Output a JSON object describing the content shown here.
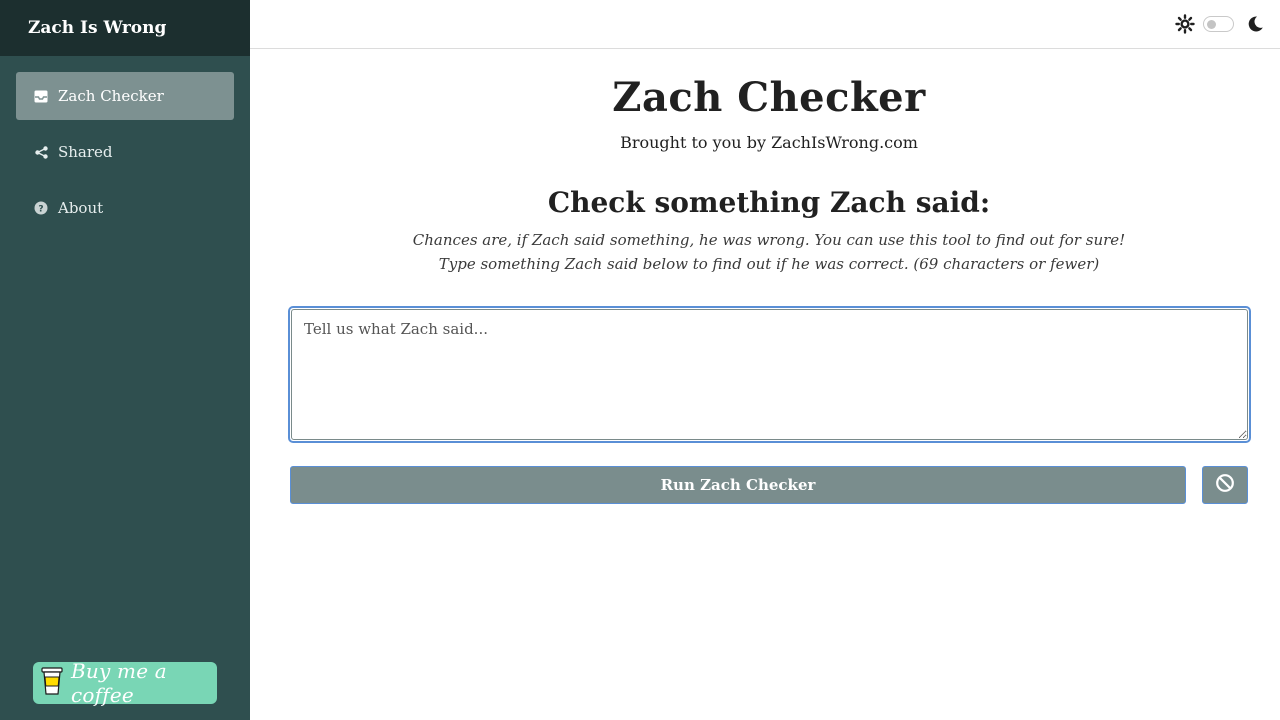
{
  "app": {
    "brand": "Zach Is Wrong"
  },
  "sidebar": {
    "items": [
      {
        "label": "Zach Checker",
        "icon": "inbox-icon",
        "active": true
      },
      {
        "label": "Shared",
        "icon": "share-icon",
        "active": false
      },
      {
        "label": "About",
        "icon": "help-circle-icon",
        "active": false
      }
    ],
    "coffee_label": "Buy me a coffee"
  },
  "topbar": {
    "theme_icons": [
      "sun-icon",
      "moon-icon"
    ],
    "dark_mode": false
  },
  "main": {
    "title": "Zach Checker",
    "subtitle": "Brought to you by ZachIsWrong.com",
    "heading": "Check something Zach said:",
    "description_line1": "Chances are, if Zach said something, he was wrong. You can use this tool to find out for sure!",
    "description_line2": "Type something Zach said below to find out if he was correct. (69 characters or fewer)",
    "input_placeholder": "Tell us what Zach said...",
    "run_button": "Run Zach Checker",
    "clear_icon": "block-icon"
  },
  "colors": {
    "sidebar": "#2f4f4f",
    "brand_bar": "#1c2f2f",
    "active_item": "#7d9191",
    "button": "#7a8d8d",
    "focus": "#5a8fd6",
    "coffee": "#79d6b5"
  }
}
